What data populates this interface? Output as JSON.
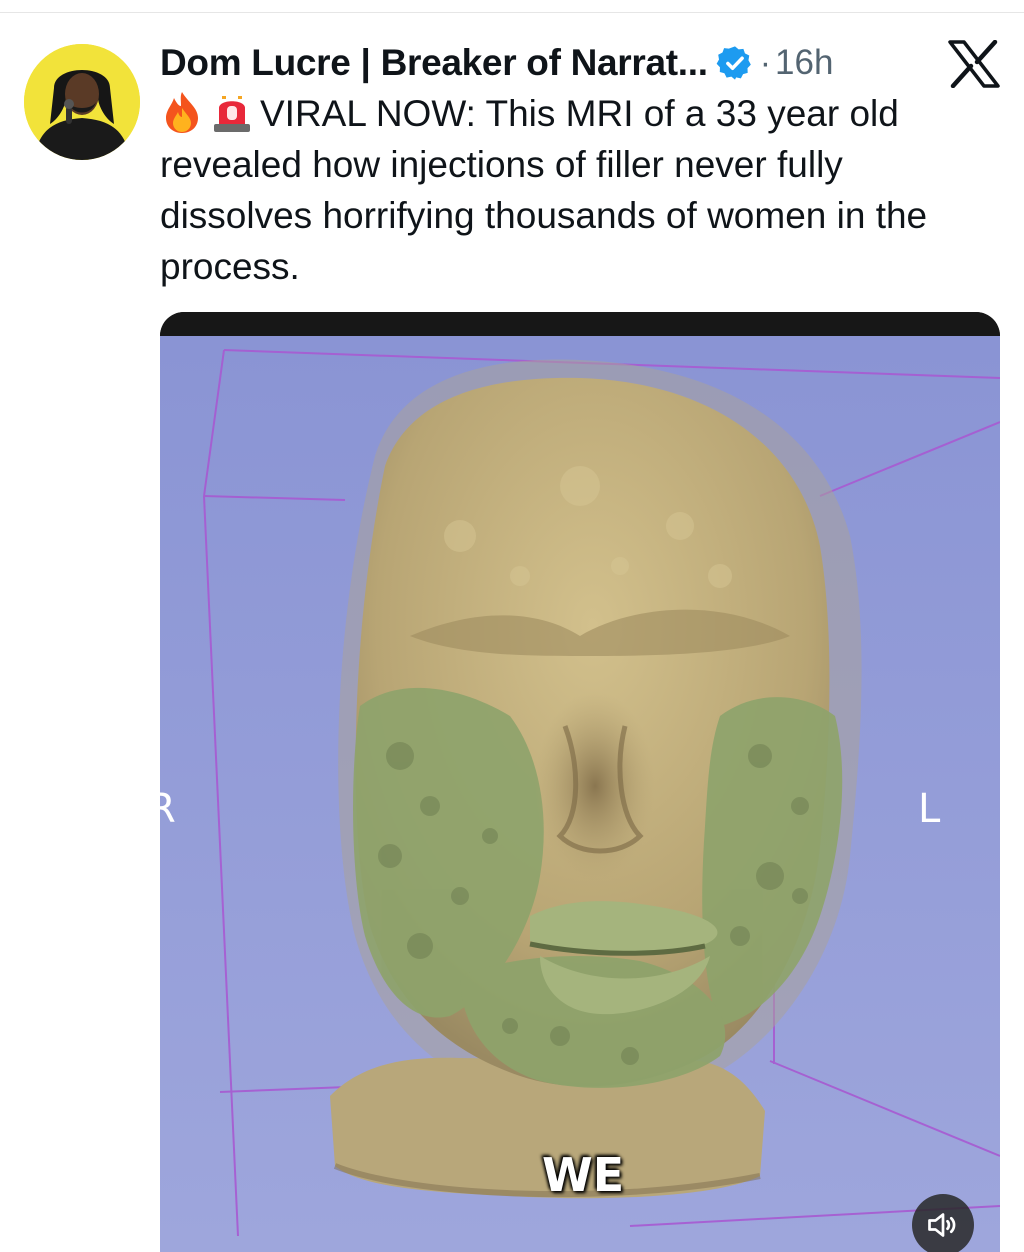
{
  "post": {
    "author_name": "Dom Lucre | Breaker of Narrat...",
    "dot": "·",
    "time": "16h",
    "text_emojis": [
      "fire-emoji",
      "siren-emoji"
    ],
    "text": "VIRAL NOW: This MRI of a 33 year old revealed how injections of filler never fully dissolves horrifying thousands of women in the process."
  },
  "icons": {
    "verified": "verified-badge-icon",
    "platform": "x-logo-icon",
    "volume": "volume-icon"
  },
  "media": {
    "label_left": "R",
    "label_right": "L",
    "caption": "WE"
  },
  "colors": {
    "verified_blue": "#1d9bf0",
    "scene_background": "#8f98d6",
    "bounding_box": "#a75ad1",
    "head_tan": "#c7b380",
    "filler_green": "#8ea36b"
  }
}
